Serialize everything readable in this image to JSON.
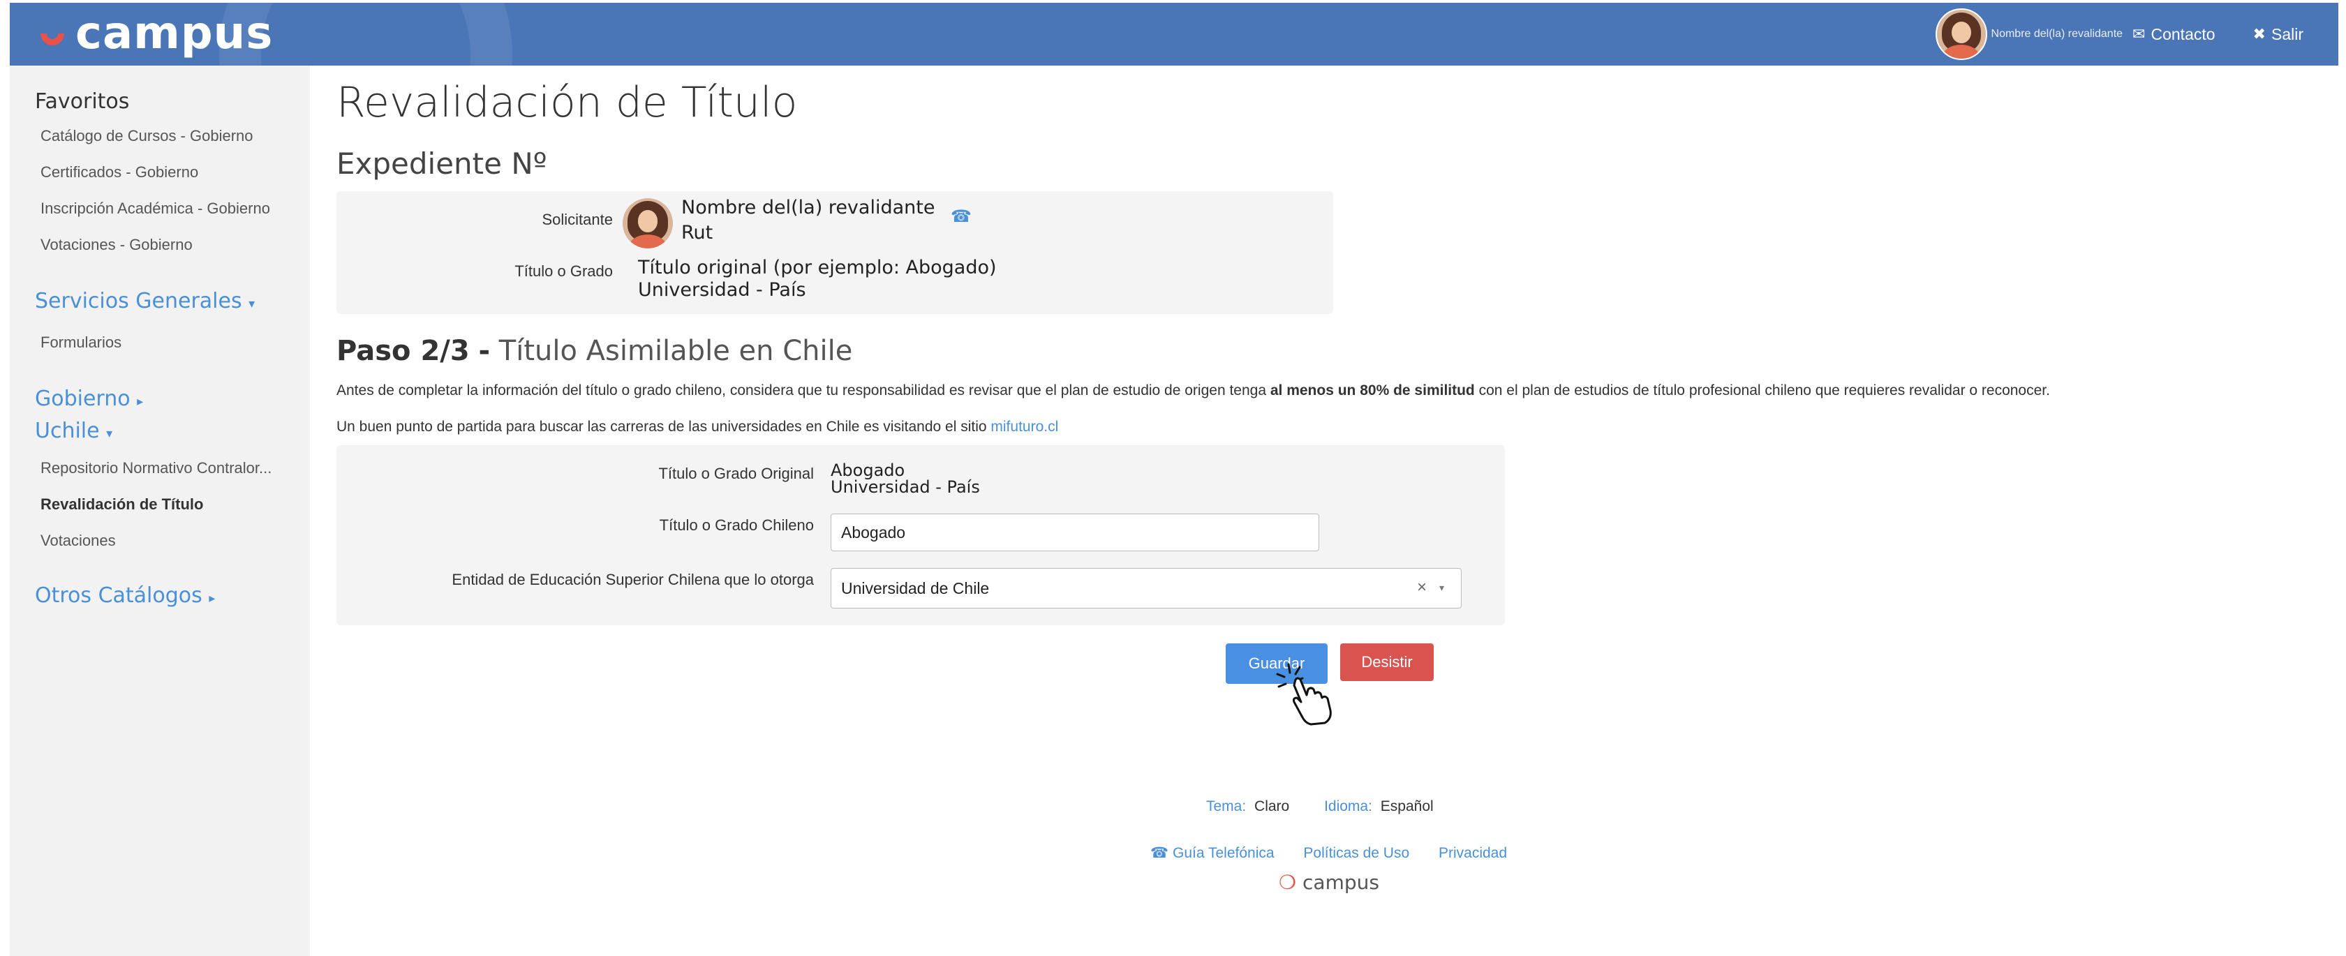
{
  "header": {
    "logo_text": "campus",
    "username": "Nombre del(la) revalidante",
    "contact_label": "Contacto",
    "logout_label": "Salir",
    "contact_icon": "mail-icon",
    "logout_icon": "close-icon",
    "bar_color": "#4a76b8"
  },
  "sidebar": {
    "favorites_title": "Favoritos",
    "favorites": [
      "Catálogo de Cursos - Gobierno",
      "Certificados - Gobierno",
      "Inscripción Académica - Gobierno",
      "Votaciones - Gobierno"
    ],
    "servicios_title": "Servicios Generales",
    "servicios_items": [
      "Formularios"
    ],
    "gobierno_title": "Gobierno",
    "uchile_title": "Uchile",
    "uchile_items": [
      "Repositorio Normativo Contralor...",
      "Revalidación de Título",
      "Votaciones"
    ],
    "otros_title": "Otros Catálogos",
    "active_item": "Revalidación de Título"
  },
  "page": {
    "title": "Revalidación de Título",
    "expediente": "Expediente Nº"
  },
  "solicitante": {
    "label": "Solicitante",
    "name": "Nombre del(la) revalidante",
    "rut": "Rut",
    "titulo_label": "Título o Grado",
    "titulo_value": "Título original (por ejemplo: Abogado)",
    "universidad": "Universidad - País",
    "phone_icon": "phone-icon"
  },
  "step": {
    "number": "Paso 2/3",
    "separator": "-",
    "name": "Título Asimilable en Chile",
    "intro_before": "Antes de completar la información del título o grado chileno, considera que tu responsabilidad es revisar que el plan de estudio de origen tenga",
    "intro_bold": "al menos un 80% de similitud",
    "intro_after": "con el plan de estudios de título profesional chileno que requieres revalidar o reconocer.",
    "hint_before": "Un buen punto de partida para buscar las carreras de las universidades en Chile es visitando el sitio",
    "hint_link": "mifuturo.cl"
  },
  "form": {
    "original_label": "Título o Grado Original",
    "original_value": "Abogado",
    "original_univ": "Universidad - País",
    "chileno_label": "Título o Grado Chileno",
    "chileno_value": "Abogado",
    "entidad_label": "Entidad de Educación Superior Chilena que lo otorga",
    "entidad_value": "Universidad de Chile",
    "clear_icon": "×",
    "caret_icon": "▾"
  },
  "actions": {
    "save_label": "Guardar",
    "cancel_label": "Desistir",
    "save_color": "#4a90e2",
    "cancel_color": "#d9534f"
  },
  "footer": {
    "tema_label": "Tema:",
    "tema_value": "Claro",
    "idioma_label": "Idioma:",
    "idioma_value": "Español",
    "guia": "Guía Telefónica",
    "politicas": "Políticas de Uso",
    "privacidad": "Privacidad",
    "logo_text": "campus"
  }
}
